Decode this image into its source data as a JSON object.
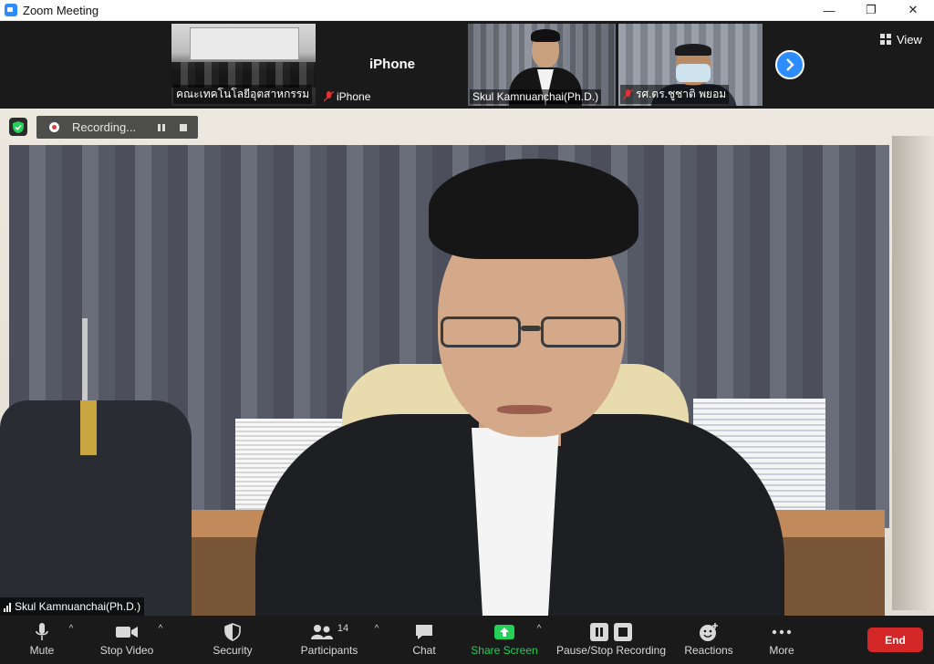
{
  "window": {
    "title": "Zoom Meeting",
    "controls": {
      "minimize": "—",
      "maximize": "❐",
      "close": "✕"
    }
  },
  "strip": {
    "thumbnails": [
      {
        "name": "คณะเทคโนโลยีอุตสาหกรรม",
        "muted": false,
        "video": true
      },
      {
        "name": "iPhone",
        "display_name": "iPhone",
        "muted": true,
        "video": false
      },
      {
        "name": "Skul Kamnuanchai(Ph.D.)",
        "muted": false,
        "video": true,
        "active_speaker": true
      },
      {
        "name": "รศ.ดร.ชูชาติ  พยอม",
        "muted": true,
        "video": true
      }
    ],
    "view_label": "View"
  },
  "main_video": {
    "speaker_name": "Skul Kamnuanchai(Ph.D.)",
    "recording_label": "Recording..."
  },
  "toolbar": {
    "mute": "Mute",
    "stop_video": "Stop Video",
    "security": "Security",
    "participants": "Participants",
    "participants_count": "14",
    "chat": "Chat",
    "share_screen": "Share Screen",
    "pause_stop_recording": "Pause/Stop Recording",
    "reactions": "Reactions",
    "more": "More",
    "end": "End"
  },
  "colors": {
    "accent": "#2d8cff",
    "share": "#25d058",
    "end": "#d32727",
    "active_speaker_border": "#8ccf3d"
  }
}
